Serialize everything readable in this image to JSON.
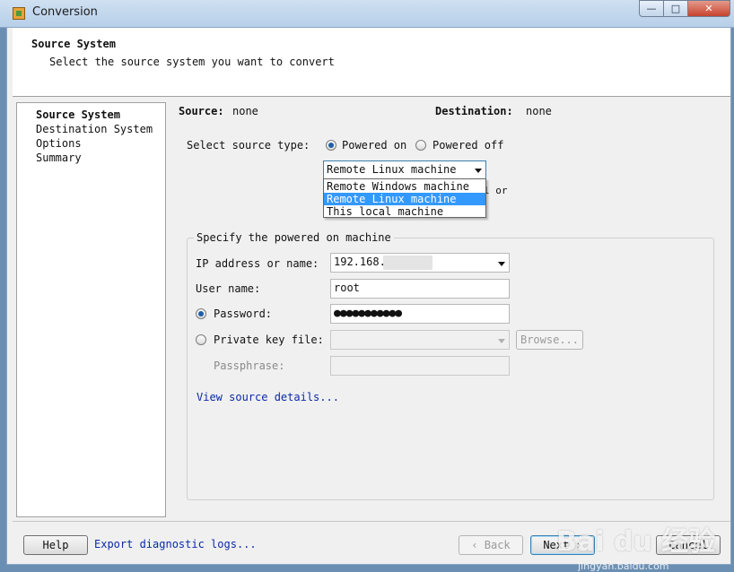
{
  "window": {
    "title": "Conversion",
    "controls": {
      "minimize": "—",
      "maximize": "□",
      "close": "✕"
    }
  },
  "header": {
    "title": "Source System",
    "subtitle": "Select the source system you want to convert"
  },
  "steps": [
    "Source System",
    "Destination System",
    "Options",
    "Summary"
  ],
  "summary": {
    "source_label": "Source:",
    "source_value": "none",
    "destination_label": "Destination:",
    "destination_value": "none"
  },
  "source_type": {
    "label": "Select source type:",
    "powered_on": "Powered on",
    "powered_off": "Powered off",
    "selected_machine": "Remote Linux machine",
    "options": [
      "Remote Windows machine",
      "Remote Linux machine",
      "This local machine"
    ],
    "hidden_text_fragment": "l or"
  },
  "group": {
    "title": "Specify the powered on machine",
    "ip_label": "IP address or name:",
    "ip_value": "192.168.",
    "user_label": "User name:",
    "user_value": "root",
    "password_label": "Password:",
    "password_value": "●●●●●●●●●●●",
    "private_key_label": "Private key file:",
    "browse_label": "Browse...",
    "passphrase_label": "Passphrase:",
    "details_link": "View source details..."
  },
  "footer": {
    "help": "Help",
    "export_link": "Export diagnostic logs...",
    "back": "‹ Back",
    "next": "Next ›",
    "cancel": "Cancel"
  },
  "watermark": {
    "text": "Bai du 经验",
    "sub": "jingyan.baidu.com"
  },
  "colors": {
    "accent": "#3399ff",
    "link": "#0a2aa8",
    "titlebar": "#b7cfe8"
  }
}
